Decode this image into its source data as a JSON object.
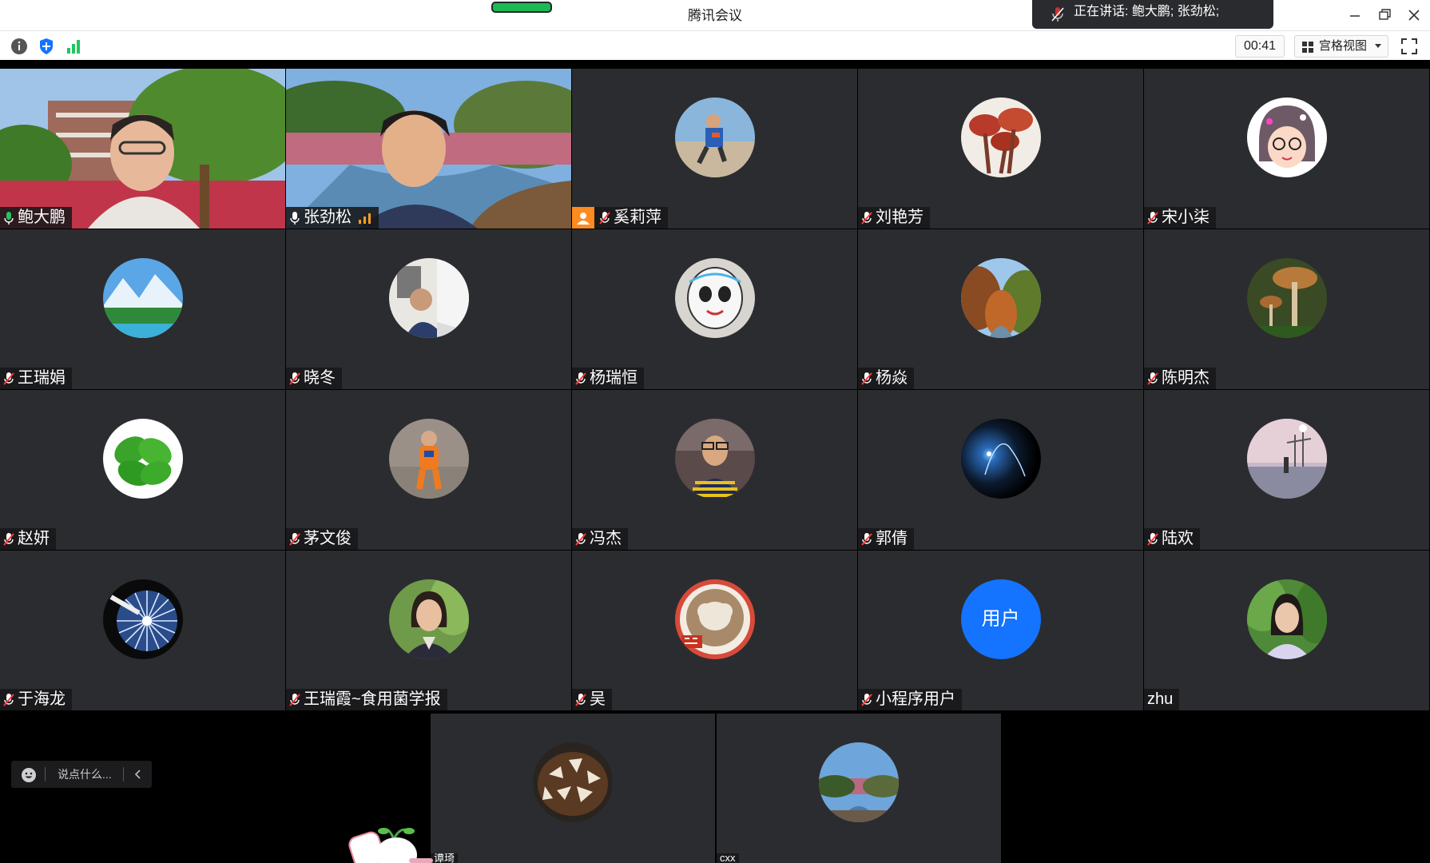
{
  "window": {
    "title": "腾讯会议"
  },
  "speaking": {
    "label": "正在讲话: 鲍大鹏; 张劲松;"
  },
  "toolbar": {
    "timer": "00:41",
    "view_label": "宫格视图"
  },
  "participants": [
    {
      "name": "鲍大鹏",
      "type": "video",
      "mic": "on",
      "active": true
    },
    {
      "name": "张劲松",
      "type": "video",
      "mic": "on",
      "speaking": true
    },
    {
      "name": "奚莉萍",
      "type": "avatar",
      "mic": "off",
      "host": true,
      "avatar": "boy-beach"
    },
    {
      "name": "刘艳芳",
      "type": "avatar",
      "mic": "off",
      "avatar": "mushroom-red"
    },
    {
      "name": "宋小柒",
      "type": "avatar",
      "mic": "off",
      "avatar": "cartoon-girl"
    },
    {
      "name": "王瑞娟",
      "type": "avatar",
      "mic": "off",
      "avatar": "mountain-landscape"
    },
    {
      "name": "晓冬",
      "type": "avatar",
      "mic": "off",
      "avatar": "man-office"
    },
    {
      "name": "杨瑞恒",
      "type": "avatar",
      "mic": "off",
      "avatar": "panda-mascot"
    },
    {
      "name": "杨焱",
      "type": "avatar",
      "mic": "off",
      "avatar": "autumn-forest"
    },
    {
      "name": "陈明杰",
      "type": "avatar",
      "mic": "off",
      "avatar": "mushroom-brown"
    },
    {
      "name": "赵妍",
      "type": "avatar",
      "mic": "off",
      "avatar": "green-leaves"
    },
    {
      "name": "茅文俊",
      "type": "avatar",
      "mic": "off",
      "avatar": "child-orange"
    },
    {
      "name": "冯杰",
      "type": "avatar",
      "mic": "off",
      "avatar": "man-striped"
    },
    {
      "name": "郭倩",
      "type": "avatar",
      "mic": "off",
      "avatar": "blue-light"
    },
    {
      "name": "陆欢",
      "type": "avatar",
      "mic": "off",
      "avatar": "sunset-scene"
    },
    {
      "name": "于海龙",
      "type": "avatar",
      "mic": "off",
      "avatar": "mushroom-gills"
    },
    {
      "name": "王瑞霞~食用菌学报",
      "type": "avatar",
      "mic": "off",
      "avatar": "woman-portrait"
    },
    {
      "name": "吴",
      "type": "avatar",
      "mic": "off",
      "avatar": "latte-art"
    },
    {
      "name": "小程序用户",
      "type": "text-avatar",
      "mic": "off",
      "avatar_text": "用户"
    },
    {
      "name": "zhu",
      "type": "avatar",
      "mic": "none",
      "avatar": "woman-green"
    }
  ],
  "bottom": {
    "tiles": [
      {
        "name": "谭琦",
        "avatar": "shiitake"
      },
      {
        "name": "cxx",
        "avatar": "river-blossom"
      }
    ]
  },
  "chat": {
    "placeholder": "说点什么..."
  },
  "colors": {
    "accent": "#22c55e",
    "host": "#ff8a1f",
    "text_avatar": "#1473ff"
  }
}
